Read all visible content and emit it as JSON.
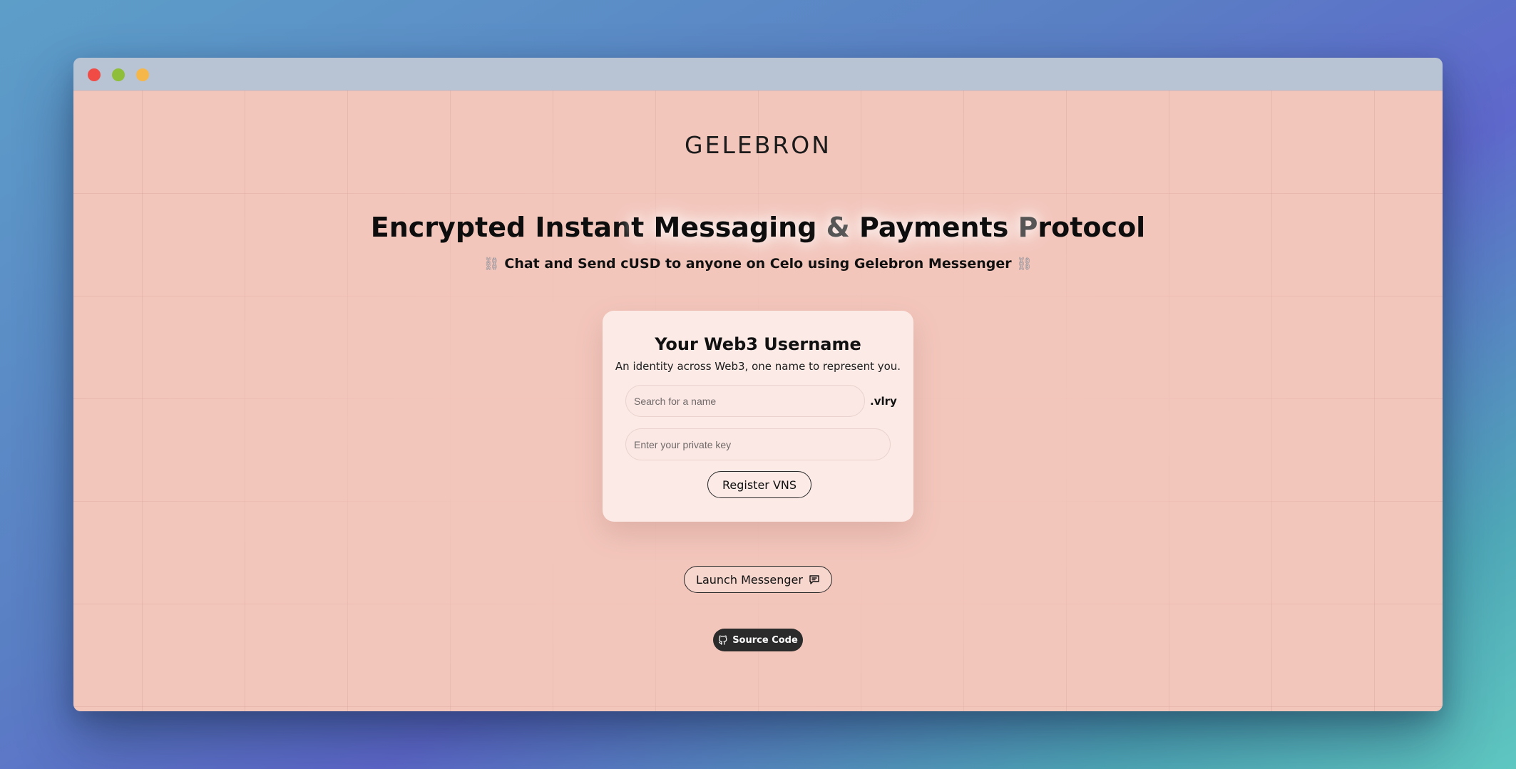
{
  "window": {
    "controls": [
      "close",
      "minimize",
      "zoom"
    ]
  },
  "brand": {
    "logo_text": "GELEBRON"
  },
  "hero": {
    "headline_parts": {
      "p1": "Encrypted Instan",
      "p2": "t",
      "p3": " ",
      "p4": "Messaging",
      "p5": " ",
      "p6": "&",
      "p7": " ",
      "p8": "Payments",
      "p9": " ",
      "p10": "P",
      "p11": "rotocol"
    },
    "subline_emoji": "⛓",
    "subline": "Chat and Send cUSD to anyone on Celo using Gelebron Messenger"
  },
  "card": {
    "title": "Your Web3 Username",
    "subtitle": "An identity across Web3, one name to represent you.",
    "name_placeholder": "Search for a name",
    "suffix": ".vlry",
    "key_placeholder": "Enter your private key",
    "register_label": "Register VNS"
  },
  "actions": {
    "launch_label": "Launch Messenger",
    "launch_icon": "chat-bubble-icon",
    "source_label": "Source Code",
    "source_icon": "github-icon"
  },
  "colors": {
    "page_bg": "#f3c6bc",
    "card_bg": "#fbeae6",
    "titlebar": "#b8c3d3",
    "dark_button": "#2b2b2b"
  }
}
